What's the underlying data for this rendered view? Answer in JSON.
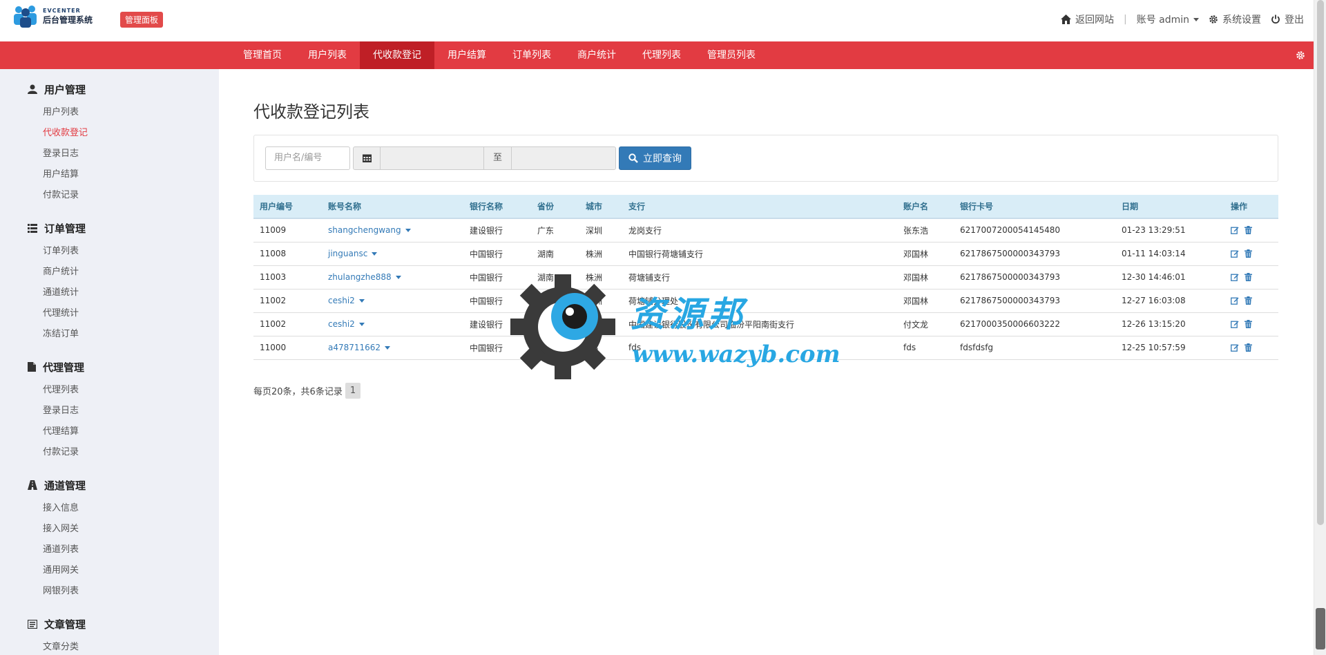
{
  "header": {
    "logo_en": "EVCENTER",
    "logo_cn": "后台管理系统",
    "panel_badge": "管理面板",
    "back_site": "返回网站",
    "account": "账号 admin",
    "settings": "系统设置",
    "logout": "登出"
  },
  "nav": {
    "items": [
      "管理首页",
      "用户列表",
      "代收款登记",
      "用户结算",
      "订单列表",
      "商户统计",
      "代理列表",
      "管理员列表"
    ],
    "active_index": 2
  },
  "sidebar": {
    "groups": [
      {
        "title": "用户管理",
        "icon": "user-icon",
        "items": [
          "用户列表",
          "代收款登记",
          "登录日志",
          "用户结算",
          "付款记录"
        ]
      },
      {
        "title": "订单管理",
        "icon": "list-icon",
        "items": [
          "订单列表",
          "商户统计",
          "通道统计",
          "代理统计",
          "冻结订单"
        ]
      },
      {
        "title": "代理管理",
        "icon": "file-icon",
        "items": [
          "代理列表",
          "登录日志",
          "代理结算",
          "付款记录"
        ]
      },
      {
        "title": "通道管理",
        "icon": "road-icon",
        "items": [
          "接入信息",
          "接入网关",
          "通道列表",
          "通用网关",
          "网银列表"
        ]
      },
      {
        "title": "文章管理",
        "icon": "article-icon",
        "items": [
          "文章分类"
        ]
      }
    ],
    "active_item": "代收款登记"
  },
  "main": {
    "title": "代收款登记列表",
    "filter": {
      "user_placeholder": "用户名/编号",
      "to_label": "至",
      "search_label": "立即查询"
    },
    "table": {
      "headers": [
        "用户编号",
        "账号名称",
        "银行名称",
        "省份",
        "城市",
        "支行",
        "账户名",
        "银行卡号",
        "日期",
        "操作"
      ],
      "rows": [
        [
          "11009",
          "shangchengwang",
          "建设银行",
          "广东",
          "深圳",
          "龙岗支行",
          "张东浩",
          "6217007200054145480",
          "01-23 13:29:51"
        ],
        [
          "11008",
          "jinguansc",
          "中国银行",
          "湖南",
          "株洲",
          "中国银行荷塘铺支行",
          "邓国林",
          "6217867500000343793",
          "01-11 14:03:14"
        ],
        [
          "11003",
          "zhulangzhe888",
          "中国银行",
          "湖南",
          "株洲",
          "荷塘铺支行",
          "邓国林",
          "6217867500000343793",
          "12-30 14:46:01"
        ],
        [
          "11002",
          "ceshi2",
          "中国银行",
          "湖南",
          "株洲",
          "荷塘铺分理处",
          "邓国林",
          "6217867500000343793",
          "12-27 16:03:08"
        ],
        [
          "11002",
          "ceshi2",
          "建设银行",
          "山西",
          "临汾",
          "中国建设银行股份有限公司临汾平阳南街支行",
          "付文龙",
          "6217000350006603222",
          "12-26 13:15:20"
        ],
        [
          "11000",
          "a478711662",
          "中国银行",
          "fdsaf",
          "fds",
          "fds",
          "fds",
          "fdsfdsfg",
          "12-25 10:57:59"
        ]
      ]
    },
    "pager": {
      "summary": "每页20条，共6条记录",
      "current": "1"
    }
  },
  "watermark": {
    "cn": "资源邦",
    "url": "www.wazyb.com"
  },
  "colors": {
    "nav_red": "#e23b42",
    "nav_active": "#bf1f26",
    "link_blue": "#337ab7",
    "header_bg": "#d9edf7"
  }
}
